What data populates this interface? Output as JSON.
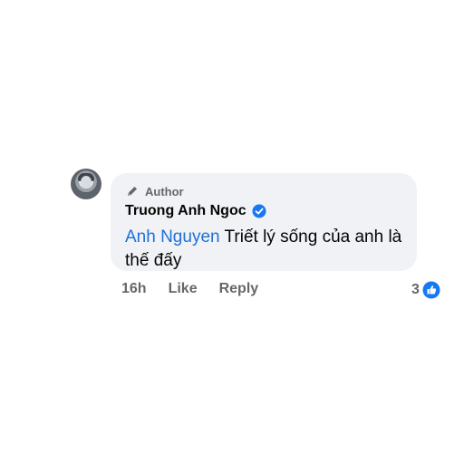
{
  "comment": {
    "author_badge": "Author",
    "author_name": "Truong Anh Ngoc",
    "mention": "Anh Nguyen",
    "text": "Triết lý sống của anh là thế đấy",
    "time": "16h",
    "like_label": "Like",
    "reply_label": "Reply",
    "reaction_count": "3"
  },
  "colors": {
    "bubble": "#f0f2f5",
    "mention": "#216fdb",
    "verified": "#1877f2",
    "muted": "#65676b"
  },
  "icons": {
    "author_badge": "pencil-icon",
    "verified": "verified-badge-icon",
    "reaction": "like-icon"
  }
}
